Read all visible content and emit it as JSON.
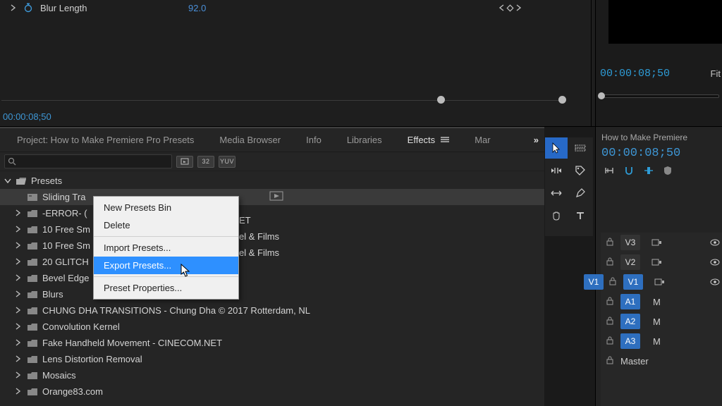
{
  "fx": {
    "param_name": "Blur Length",
    "param_value": "92.0",
    "timecode": "00:00:08;50"
  },
  "preview": {
    "timecode": "00:00:08;50",
    "fit_label": "Fit"
  },
  "timeline": {
    "title": "How to Make Premiere",
    "timecode": "00:00:08;50"
  },
  "tabs": {
    "project": "Project: How to Make Premiere Pro Presets",
    "media_browser": "Media Browser",
    "info": "Info",
    "libraries": "Libraries",
    "effects": "Effects",
    "markers": "Mar"
  },
  "effects_search": "",
  "badges": {
    "a": "",
    "b": "32",
    "c": "YUV"
  },
  "tree": {
    "root": "Presets",
    "items": [
      "Sliding Tra",
      "-ERROR- (",
      "10 Free Sm",
      "10 Free Sm",
      "20 GLITCH",
      "Bevel Edge",
      "Blurs",
      "CHUNG DHA TRANSITIONS - Chung Dha © 2017 Rotterdam, NL",
      "Convolution Kernel",
      "Fake Handheld Movement - CINECOM.NET",
      "Lens Distortion Removal",
      "Mosaics",
      "Orange83.com"
    ],
    "peek": [
      "ET",
      "el & Films",
      "el & Films"
    ]
  },
  "ctx_menu": {
    "new_bin": "New Presets Bin",
    "delete": "Delete",
    "import": "Import Presets...",
    "export": "Export Presets...",
    "props": "Preset Properties..."
  },
  "tracks": {
    "v3": "V3",
    "v2": "V2",
    "v1": "V1",
    "a1": "A1",
    "a2": "A2",
    "a3": "A3",
    "master": "Master",
    "m": "M"
  }
}
